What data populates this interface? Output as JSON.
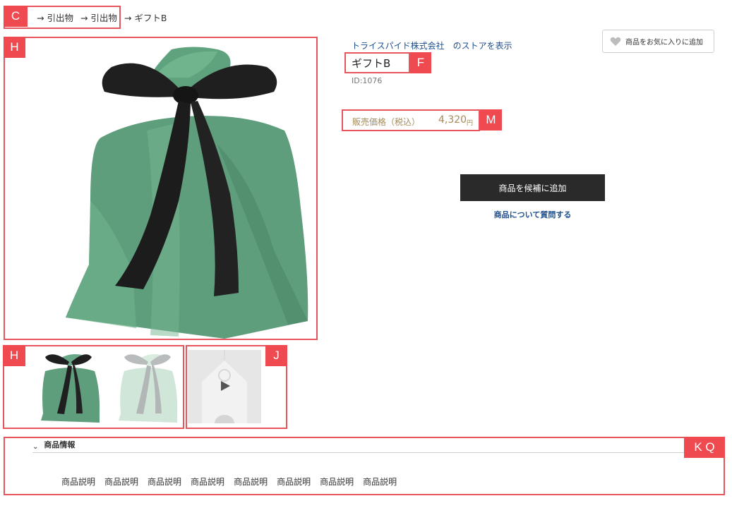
{
  "breadcrumb": {
    "items": [
      "→ 引出物",
      "→ 引出物",
      "→ ギフトB"
    ]
  },
  "store": {
    "link": "トライスパイド株式会社　のストアを表示"
  },
  "favorite": {
    "label": "商品をお気に入りに追加",
    "icon": "heart-icon"
  },
  "product": {
    "title": "ギフトB",
    "id": "ID:1076",
    "price_label": "販売価格（税込）",
    "price": "4,320",
    "price_unit": "円"
  },
  "actions": {
    "add_candidate": "商品を候補に追加",
    "ask": "商品について質問する"
  },
  "info": {
    "header": "商品情報",
    "descriptions": [
      "商品説明",
      "商品説明",
      "商品説明",
      "商品説明",
      "商品説明",
      "商品説明",
      "商品説明",
      "商品説明"
    ]
  },
  "annotations": {
    "c": "C",
    "h1": "H",
    "f": "F",
    "m": "M",
    "h2": "H",
    "j": "J",
    "kq": "K Q"
  },
  "colors": {
    "annotation": "#ee4a50",
    "price": "#a68a58",
    "link": "#1c4f8f",
    "button": "#2a2a2a",
    "bag_green": "#5aa07a",
    "ribbon": "#1e1e1e"
  }
}
